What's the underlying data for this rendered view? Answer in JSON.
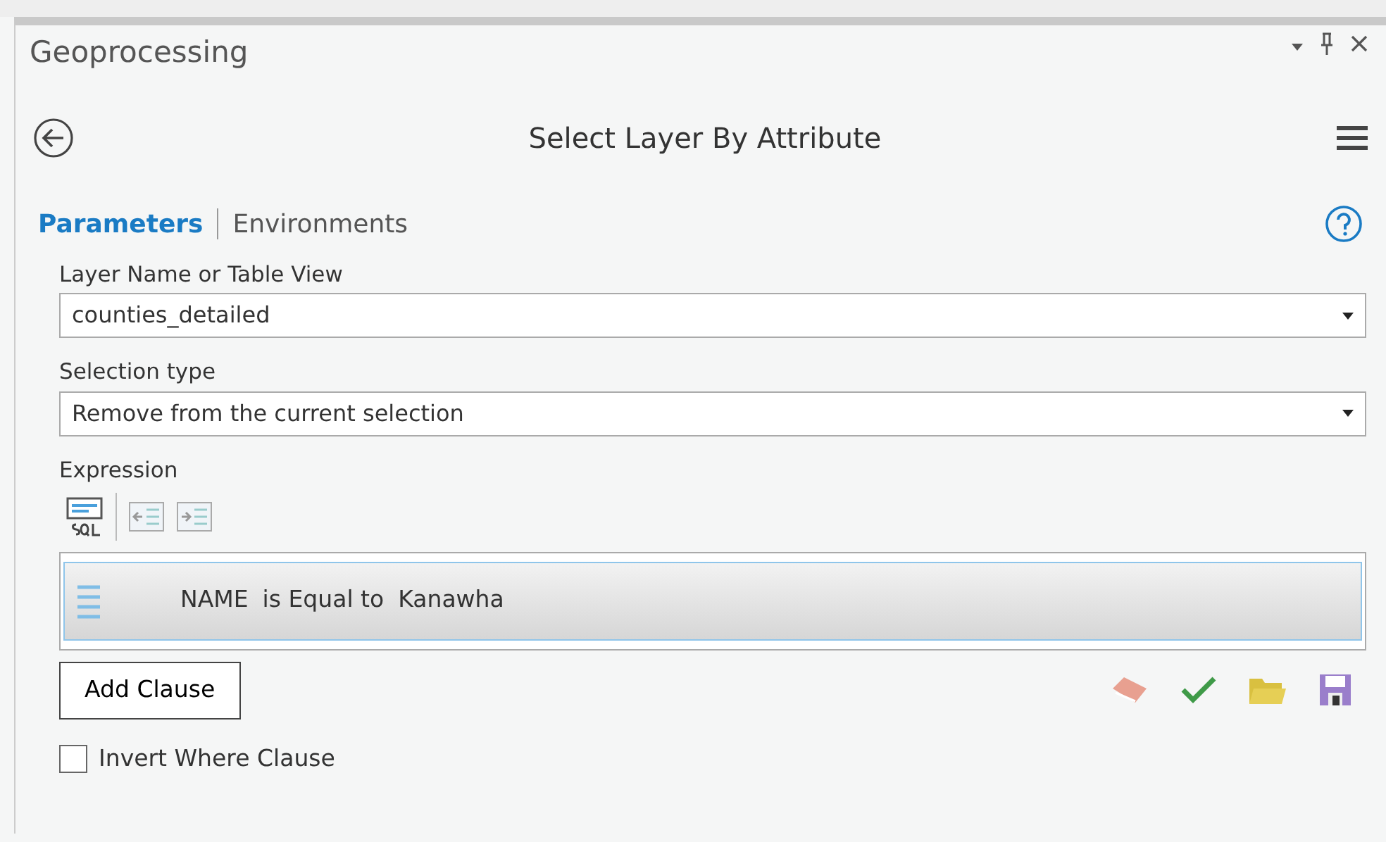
{
  "pane": {
    "title": "Geoprocessing"
  },
  "tool": {
    "title": "Select Layer By Attribute"
  },
  "tabs": [
    {
      "label": "Parameters",
      "selected": true
    },
    {
      "label": "Environments",
      "selected": false
    }
  ],
  "fields": [
    {
      "label": "Layer Name or Table View",
      "value": "counties_detailed"
    },
    {
      "label": "Selection type",
      "value": "Remove from the current selection"
    }
  ],
  "expression": {
    "label": "Expression",
    "clauses": [
      {
        "field": "NAME",
        "operator": "is Equal to",
        "value": "Kanawha",
        "selected": true
      }
    ],
    "add_button": "Add Clause"
  },
  "invert": {
    "label": "Invert Where Clause",
    "checked": false
  }
}
